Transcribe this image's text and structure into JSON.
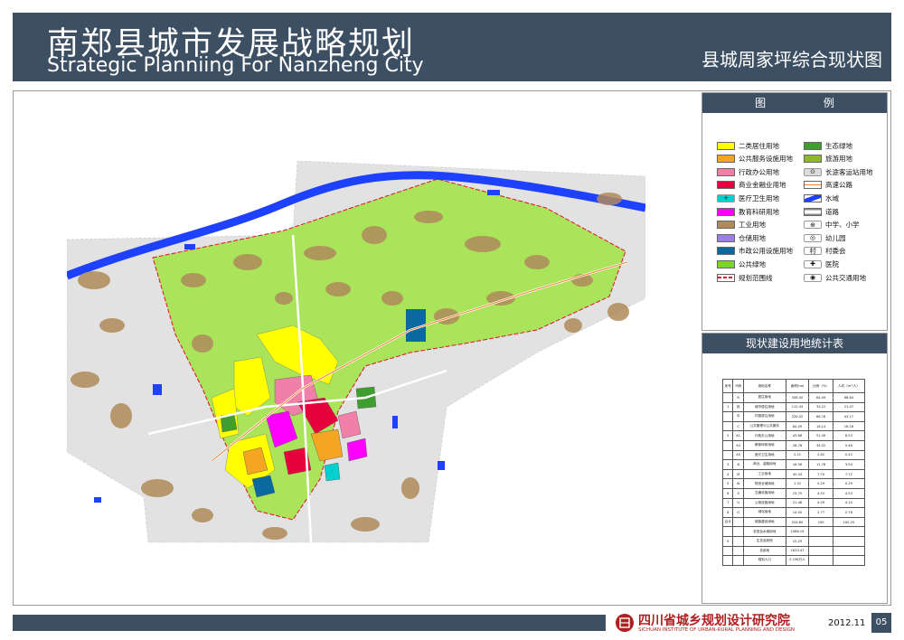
{
  "header": {
    "title_cn": "南郑县城市发展战略规划",
    "title_en": "Strategic Planniing For Nanzheng City",
    "map_title": "县城周家坪综合现状图"
  },
  "legend": {
    "title": "图    例",
    "items": [
      {
        "label": "二类居住用地",
        "color": "#ffff00",
        "kind": "swatch"
      },
      {
        "label": "生态绿地",
        "color": "#3f9e2f",
        "kind": "swatch"
      },
      {
        "label": "公共服务设施用地",
        "color": "#f4a623",
        "kind": "swatch"
      },
      {
        "label": "旅游用地",
        "color": "#8fb82e",
        "kind": "swatch"
      },
      {
        "label": "行政办公用地",
        "color": "#f080a8",
        "kind": "swatch"
      },
      {
        "label": "长途客运站用地",
        "color": "#dcdcdc",
        "kind": "symbol",
        "glyph": "⊙"
      },
      {
        "label": "商业金融业用地",
        "color": "#e6003c",
        "kind": "swatch"
      },
      {
        "label": "高速公路",
        "color": "#f08030",
        "kind": "line"
      },
      {
        "label": "医疗卫生用地",
        "color": "#00d0d0",
        "kind": "symbol",
        "glyph": "+"
      },
      {
        "label": "水域",
        "color": "#1e40ff",
        "kind": "water"
      },
      {
        "label": "教育科研用地",
        "color": "#ff00ff",
        "kind": "swatch"
      },
      {
        "label": "道路",
        "color": "#ffffff",
        "kind": "road"
      },
      {
        "label": "工业用地",
        "color": "#b08a5a",
        "kind": "swatch"
      },
      {
        "label": "中学、小学",
        "color": "#ffffff",
        "kind": "symbol",
        "glyph": "⊕"
      },
      {
        "label": "仓储用地",
        "color": "#9b7fe6",
        "kind": "swatch"
      },
      {
        "label": "幼儿园",
        "color": "#ffffff",
        "kind": "symbol",
        "glyph": "◎"
      },
      {
        "label": "市政公用设施用地",
        "color": "#0a6aa0",
        "kind": "swatch"
      },
      {
        "label": "村委会",
        "color": "#ffffff",
        "kind": "symbol",
        "glyph": "村"
      },
      {
        "label": "公共绿地",
        "color": "#7ed32a",
        "kind": "swatch"
      },
      {
        "label": "医院",
        "color": "#ffffff",
        "kind": "symbol",
        "glyph": "✚"
      },
      {
        "label": "规划范围线",
        "color": "#e0102a",
        "kind": "dash"
      },
      {
        "label": "公共交通用地",
        "color": "#ffffff",
        "kind": "symbol",
        "glyph": "◉"
      }
    ]
  },
  "stats": {
    "title": "现状建设用地统计表",
    "columns": [
      "序号",
      "代码",
      "用地名称",
      "面积(ha)",
      "比例（%）",
      "人均（m²/人）"
    ],
    "rows": [
      [
        "",
        "R",
        "居住用地",
        "338.45",
        "64.49",
        "66.64"
      ],
      [
        "1",
        "其",
        "城市居住用地",
        "112.43",
        "33.22",
        "21.47"
      ],
      [
        "",
        "中",
        "村镇居住用地",
        "226.02",
        "66.78",
        "43.17"
      ],
      [
        "",
        "C",
        "公共管理与公共服务",
        "84.09",
        "16.14",
        "16.18"
      ],
      [
        "2",
        "A1",
        "行政办公用地",
        "43.66",
        "51.49",
        "8.53"
      ],
      [
        "",
        "A3",
        "教育科研用地",
        "28.76",
        "34.02",
        "5.46"
      ],
      [
        "",
        "A5",
        "医疗卫生用地",
        "2.21",
        "2.62",
        "0.42"
      ],
      [
        "3",
        "B",
        "商业、金融用地",
        "16.56",
        "11.76",
        "3.94"
      ],
      [
        "4",
        "M",
        "工业用地",
        "40.43",
        "7.70",
        "7.72"
      ],
      [
        "5",
        "W",
        "物流仓储用地",
        "1.52",
        "0.29",
        "0.29"
      ],
      [
        "6",
        "S",
        "交通设施用地",
        "23.75",
        "4.52",
        "4.53"
      ],
      [
        "7",
        "U",
        "公用设施用地",
        "21.48",
        "4.09",
        "4.10"
      ],
      [
        "8",
        "G",
        "绿化用地",
        "14.50",
        "2.77",
        "2.78"
      ],
      [
        "合计",
        "",
        "城镇建设用地",
        "524.85",
        "100",
        "100.25"
      ],
      [
        "",
        "",
        "农田及水域用地",
        "1086.19",
        "",
        ""
      ],
      [
        "9",
        "",
        "生态及其他",
        "22.25",
        "",
        ""
      ],
      [
        "",
        "",
        "总用地",
        "1633.47",
        "",
        ""
      ],
      [
        "",
        "",
        "规划人口",
        "5.236万人",
        "",
        ""
      ]
    ]
  },
  "footer": {
    "institute_cn": "四川省城乡规划设计研究院",
    "institute_en": "SICHUAN INSTITUTE OF URBAN-RURAL PLANNING AND DESIGN",
    "date": "2012.11",
    "page": "05"
  },
  "colors": {
    "header_bg": "#3d4f63",
    "green": "#a9e45a",
    "river": "#1e40ff",
    "residential": "#ffff00",
    "industrial": "#b08a5a"
  }
}
